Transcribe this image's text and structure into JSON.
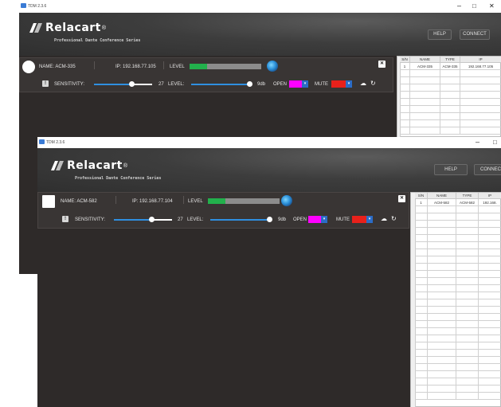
{
  "windows": [
    {
      "title": "TDM 2.3.6",
      "minimize": "–",
      "maximize": "□",
      "close": "✕",
      "brand": "Relacart",
      "registered": "®",
      "tagline": "Professional Dante Conference Series",
      "help": "HELP",
      "connect": "CONNECT",
      "device": {
        "name_label": "NAME: ACM-335",
        "ip_label": "IP: 192.168.77.105",
        "level_label": "LEVEL",
        "level_fill": 0.24,
        "sensitivity_label": "SENSITIVITY:",
        "sensitivity_value": "27",
        "sensitivity_fraction": 0.65,
        "level2_label": "LEVEL:",
        "db_value": "9db",
        "open_label": "OPEN",
        "open_color": "#ff00ff",
        "mute_label": "MUTE",
        "mute_color": "#e8211b",
        "close_btn": "✕"
      },
      "table": {
        "headers": [
          "S/N",
          "NAME",
          "TYPE",
          "IP"
        ],
        "rows": [
          [
            "1",
            "ACM-335",
            "ACM-335",
            "192.168.77.105"
          ]
        ]
      }
    },
    {
      "title": "TDM 2.3.6",
      "minimize": "–",
      "maximize": "□",
      "brand": "Relacart",
      "registered": "®",
      "tagline": "Professional Dante Conference Series",
      "help": "HELP",
      "connect": "CONNEC",
      "device": {
        "name_label": "NAME: ACM-582",
        "ip_label": "IP: 192.168.77.104",
        "level_label": "LEVEL",
        "level_fill": 0.24,
        "sensitivity_label": "SENSITIVITY:",
        "sensitivity_value": "27",
        "sensitivity_fraction": 0.65,
        "level2_label": "LEVEL:",
        "db_value": "9db",
        "open_label": "OPEN",
        "open_color": "#ff00ff",
        "mute_label": "MUTE",
        "mute_color": "#e8211b",
        "close_btn": "✕"
      },
      "table": {
        "headers": [
          "S/N",
          "NAME",
          "TYPE",
          "IP"
        ],
        "rows": [
          [
            "1",
            "ACM-582",
            "ACM-582",
            "192.168."
          ]
        ]
      }
    }
  ]
}
